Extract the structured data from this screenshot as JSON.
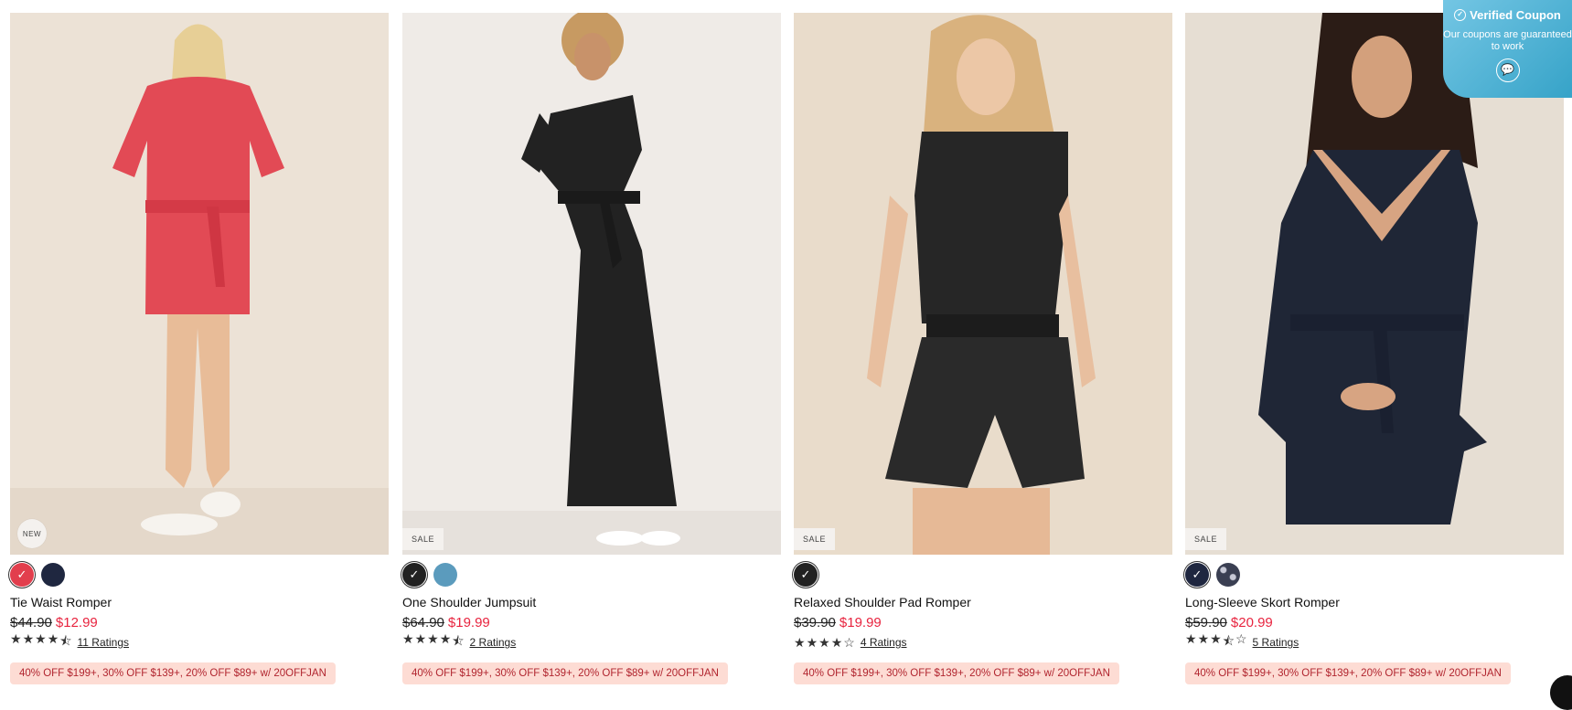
{
  "products": [
    {
      "name": "Tie Waist Romper",
      "badge": "NEW",
      "badge_style": "round",
      "was_price": "$44.90",
      "now_price": "$12.99",
      "ratings": "11 Ratings",
      "rating_value": 4.5,
      "swatches": [
        {
          "color": "#e23e4d",
          "selected": true
        },
        {
          "color": "#1f2740",
          "selected": false
        }
      ],
      "promo": "40% OFF $199+, 30% OFF $139+, 20% OFF $89+ w/ 20OFFJAN"
    },
    {
      "name": "One Shoulder Jumpsuit",
      "badge": "SALE",
      "badge_style": "square",
      "was_price": "$64.90",
      "now_price": "$19.99",
      "ratings": "2 Ratings",
      "rating_value": 4.5,
      "swatches": [
        {
          "color": "#222222",
          "selected": true
        },
        {
          "color": "#5b9bbd",
          "selected": false
        }
      ],
      "promo": "40% OFF $199+, 30% OFF $139+, 20% OFF $89+ w/ 20OFFJAN"
    },
    {
      "name": "Relaxed Shoulder Pad Romper",
      "badge": "SALE",
      "badge_style": "square",
      "was_price": "$39.90",
      "now_price": "$19.99",
      "ratings": "4 Ratings",
      "rating_value": 4,
      "swatches": [
        {
          "color": "#222222",
          "selected": true
        }
      ],
      "promo": "40% OFF $199+, 30% OFF $139+, 20% OFF $89+ w/ 20OFFJAN"
    },
    {
      "name": "Long-Sleeve Skort Romper",
      "badge": "SALE",
      "badge_style": "square",
      "was_price": "$59.90",
      "now_price": "$20.99",
      "ratings": "5 Ratings",
      "rating_value": 3.5,
      "swatches": [
        {
          "color": "#1f2740",
          "selected": true
        },
        {
          "color": "#5c6170",
          "selected": false
        }
      ],
      "promo": "40% OFF $199+, 30% OFF $139+, 20% OFF $89+ w/ 20OFFJAN"
    }
  ],
  "coupon": {
    "title": "Verified Coupon",
    "subtitle": "Our coupons are guaranteed to work"
  },
  "colors": {
    "sale_price": "#e8243f",
    "promo_bg": "#fddcd4",
    "promo_text": "#b1252f",
    "coupon_gradient_start": "#74c6e4",
    "coupon_gradient_end": "#36a3c8"
  },
  "icons": {
    "swatch_selected": "check-icon",
    "star": "star-icon",
    "coupon_badge": "verified-check-icon",
    "coupon_chat": "chat-bubble-icon"
  }
}
